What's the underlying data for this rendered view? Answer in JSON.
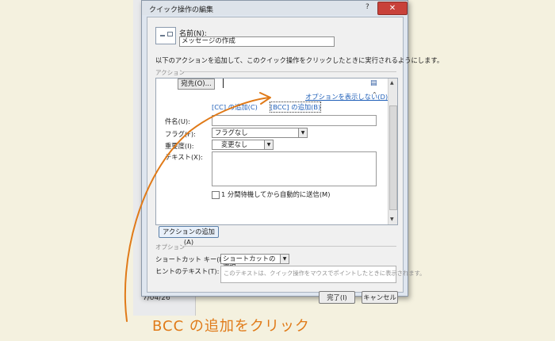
{
  "background": {
    "date_text": "7/04/26"
  },
  "dialog": {
    "title": "クイック操作の編集",
    "help": "?",
    "close": "✕",
    "name_label": "名前(N):",
    "name_value": "メッセージの作成",
    "description": "以下のアクションを追加して、このクイック操作をクリックしたときに実行されるようにします。",
    "actions_section": "アクション",
    "to_button": "宛先(O)...",
    "hide_options_link": "オプションを表示しない(D)",
    "cc_link": "[CC] の追加(C)",
    "bcc_link": "[BCC] の追加(B)",
    "subject_label": "件名(U):",
    "flag_label": "フラグ(F):",
    "flag_value": "フラグなし",
    "importance_label": "重要度(I):",
    "importance_value": "変更なし",
    "text_label": "テキスト(X):",
    "auto_send_label": "1 分間待機してから自動的に送信(M)",
    "add_action_button": "アクションの追加(A)",
    "options_section": "オプション",
    "shortcut_label": "ショートカット キー(H):",
    "shortcut_value": "ショートカットの選択",
    "hint_label": "ヒントのテキスト(T):",
    "hint_placeholder": "このテキストは、クイック操作をマウスでポイントしたときに表示されます。",
    "finish_button": "完了(I)",
    "cancel_button": "キャンセル"
  },
  "annotation": {
    "text": "BCC の追加をクリック"
  },
  "colors": {
    "annotation": "#e07a18",
    "link": "#1f5fb8"
  }
}
